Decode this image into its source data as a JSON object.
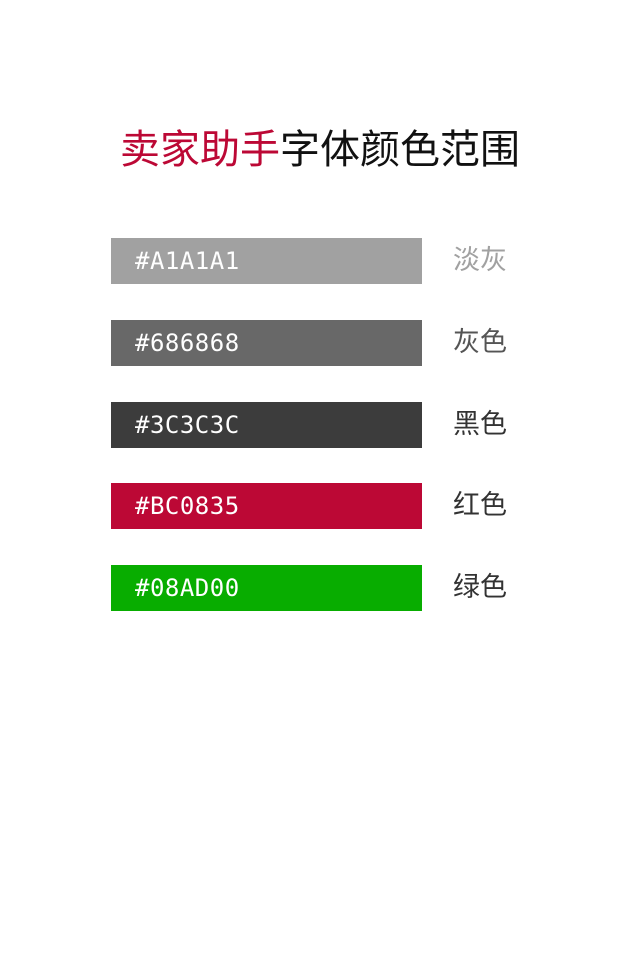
{
  "title": {
    "accent": "卖家助手",
    "rest": "字体颜色范围",
    "accent_color": "#BC0835"
  },
  "swatches": [
    {
      "hex": "#A1A1A1",
      "name": "淡灰",
      "color": "#A1A1A1",
      "label_color": "#A1A1A1"
    },
    {
      "hex": "#686868",
      "name": "灰色",
      "color": "#686868",
      "label_color": "#555555"
    },
    {
      "hex": "#3C3C3C",
      "name": "黑色",
      "color": "#3C3C3C",
      "label_color": "#333333"
    },
    {
      "hex": "#BC0835",
      "name": "红色",
      "color": "#BC0835",
      "label_color": "#333333"
    },
    {
      "hex": "#08AD00",
      "name": "绿色",
      "color": "#08AD00",
      "label_color": "#333333"
    }
  ]
}
